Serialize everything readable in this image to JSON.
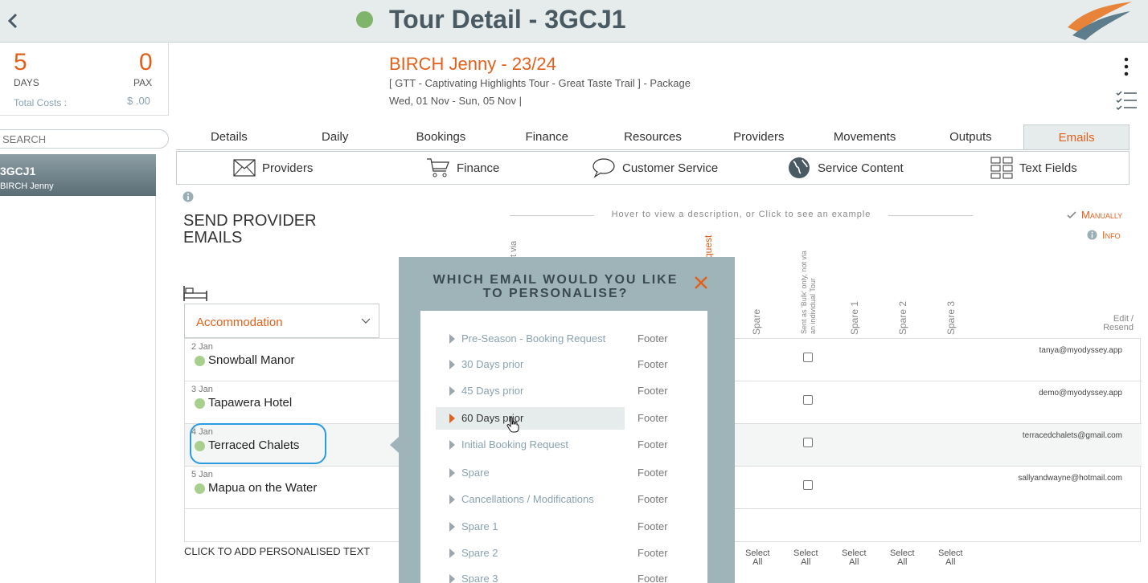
{
  "header": {
    "title": "Tour Detail - 3GCJ1"
  },
  "stats": {
    "days_value": "5",
    "days_label": "DAYS",
    "pax_value": "0",
    "pax_label": "PAX",
    "total_costs_label": "Total Costs :",
    "total_costs_value": "$ .00"
  },
  "search": {
    "placeholder": "SEARCH"
  },
  "sidebar": {
    "tour_code": "3GCJ1",
    "tour_client": "BIRCH Jenny"
  },
  "tour": {
    "name": "BIRCH Jenny - 23/24",
    "subtitle": "[ GTT - Captivating Highlights Tour - Great Taste Trail ] - Package",
    "dates": "Wed, 01 Nov  - Sun, 05 Nov  |"
  },
  "tabs": [
    "Details",
    "Daily",
    "Bookings",
    "Finance",
    "Resources",
    "Providers",
    "Movements",
    "Outputs",
    "Emails"
  ],
  "subtabs": [
    "Providers",
    "Finance",
    "Customer Service",
    "Service Content",
    "Text Fields"
  ],
  "section": {
    "title_line1": "SEND PROVIDER",
    "title_line2": "EMAILS",
    "hint": "Hover to view a description, or Click to see an example",
    "manually": "Manually",
    "info": "Info"
  },
  "column_headers": {
    "partial_via": "t via",
    "partial_request": "quest",
    "spare": "Spare",
    "bulk": "Sent as 'Bulk' only, not via",
    "bulk2": "an individual Tour",
    "spare1": "Spare 1",
    "spare2": "Spare 2",
    "spare3": "Spare 3",
    "edit_resend_1": "Edit /",
    "edit_resend_2": "Resend"
  },
  "category": {
    "selected": "Accommodation"
  },
  "providers": [
    {
      "date": "2 Jan",
      "name": "Snowball Manor",
      "email": "tanya@myodyssey.app"
    },
    {
      "date": "3 Jan",
      "name": "Tapawera Hotel",
      "email": "demo@myodyssey.app"
    },
    {
      "date": "4 Jan",
      "name": "Terraced Chalets",
      "email": "terracedchalets@gmail.com"
    },
    {
      "date": "5 Jan",
      "name": "Mapua on the Water",
      "email": "sallyandwayne@hotmail.com"
    }
  ],
  "footer": {
    "add_text": "CLICK TO ADD PERSONALISED TEXT",
    "select": "Select",
    "all": "All"
  },
  "modal": {
    "title_line1": "WHICH EMAIL WOULD YOU LIKE",
    "title_line2": "TO PERSONALISE?",
    "options": [
      {
        "label": "Pre-Season - Booking Request",
        "footer": "Footer"
      },
      {
        "label": "30 Days prior",
        "footer": "Footer"
      },
      {
        "label": "45 Days prior",
        "footer": "Footer"
      },
      {
        "label": "60 Days prior",
        "footer": "Footer"
      },
      {
        "label": "Initial Booking Request",
        "footer": "Footer"
      },
      {
        "label": "Spare",
        "footer": "Footer"
      },
      {
        "label": "Cancellations / Modifications",
        "footer": "Footer"
      },
      {
        "label": "Spare 1",
        "footer": "Footer"
      },
      {
        "label": "Spare 2",
        "footer": "Footer"
      },
      {
        "label": "Spare 3",
        "footer": "Footer"
      }
    ]
  },
  "colors": {
    "accent": "#e2601b",
    "status_green": "#7fb56a",
    "modal_bg": "#9fb4b9",
    "highlight": "#2a9be0"
  }
}
